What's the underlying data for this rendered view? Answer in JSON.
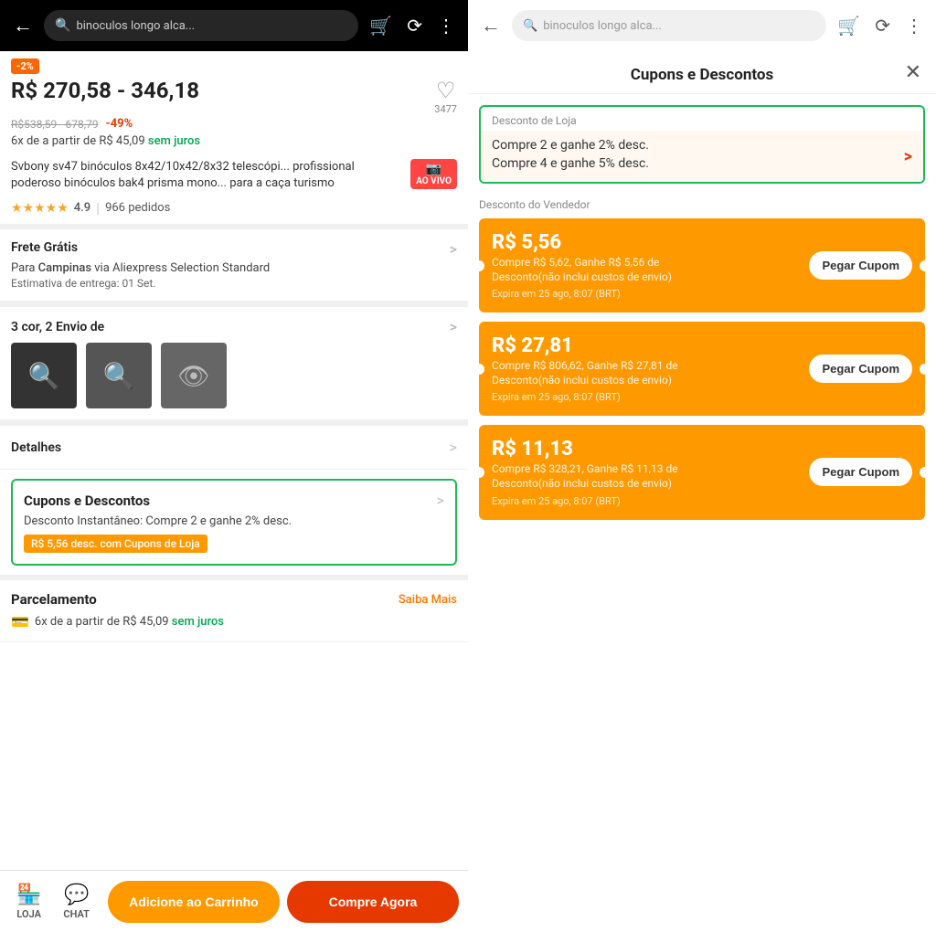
{
  "left": {
    "nav": {
      "search_placeholder": "binoculos longo alca..."
    },
    "product": {
      "discount_badge": "-2%",
      "price_main": "R$ 270,58 - 346,18",
      "old_price": "R$538,59 - 678,79",
      "discount_pct": "-49%",
      "installment": "6x de a partir de R$ 45,09",
      "sem_juros": "sem juros",
      "wishlist_count": "3477",
      "title": "Svbony sv47 binóculos 8x42/10x42/8x32 telescópi... profissional poderoso binóculos bak4 prisma mono... para a caça turismo",
      "ao_vivo": "AO VIVO",
      "rating": "4.9",
      "pedidos": "966 pedidos",
      "frete_title": "Frete Grátis",
      "frete_detail": "Para Campinas via Aliexpress Selection Standard",
      "frete_estimativa": "Estimativa de entrega: 01 Set.",
      "cor_title": "3 cor, 2 Envio de",
      "detalhes_title": "Detalhes",
      "cupons_title": "Cupons e Descontos",
      "cupons_desc": "Desconto Instantâneo: Compre 2 e ganhe 2% desc.",
      "coupon_badge": "R$ 5,56 desc. com Cupons de Loja",
      "parcelamento_title": "Parcelamento",
      "saiba_mais": "Saiba Mais",
      "parce_installment": "6x de a partir de R$ 45,09",
      "parce_sem_juros": "sem juros"
    },
    "bottom_nav": {
      "loja": "LOJA",
      "chat": "CHAT",
      "carrinho": "Adicione ao Carrinho",
      "comprar": "Compre Agora"
    }
  },
  "right": {
    "nav": {
      "search_placeholder": "binoculos longo alca..."
    },
    "modal": {
      "title": "Cupons e Descontos",
      "close": "✕",
      "desconto_loja_label": "Desconto de Loja",
      "desconto_loja_item1": "Compre 2 e ganhe 2% desc.",
      "desconto_loja_item2": "Compre 4 e ganhe 5% desc.",
      "desconto_vendedor_label": "Desconto do Vendedor",
      "coupons": [
        {
          "amount": "R$ 5,56",
          "desc": "Compre R$ 5,62, Ganhe R$ 5,56 de\nDesconto(não inclui custos de envio)",
          "expiry": "Expira em 25 ago, 8:07 (BRT)",
          "btn": "Pegar Cupom"
        },
        {
          "amount": "R$ 27,81",
          "desc": "Compre R$ 806,62, Ganhe R$ 27,81 de\nDesconto(não inclui custos de envio)",
          "expiry": "Expira em 25 ago, 8:07 (BRT)",
          "btn": "Pegar Cupom"
        },
        {
          "amount": "R$ 11,13",
          "desc": "Compre R$ 328,21, Ganhe R$ 11,13 de\nDesconto(não inclui custos de envio)",
          "expiry": "Expira em 25 ago, 8:07 (BRT)",
          "btn": "Pegar Cupom"
        }
      ]
    }
  }
}
